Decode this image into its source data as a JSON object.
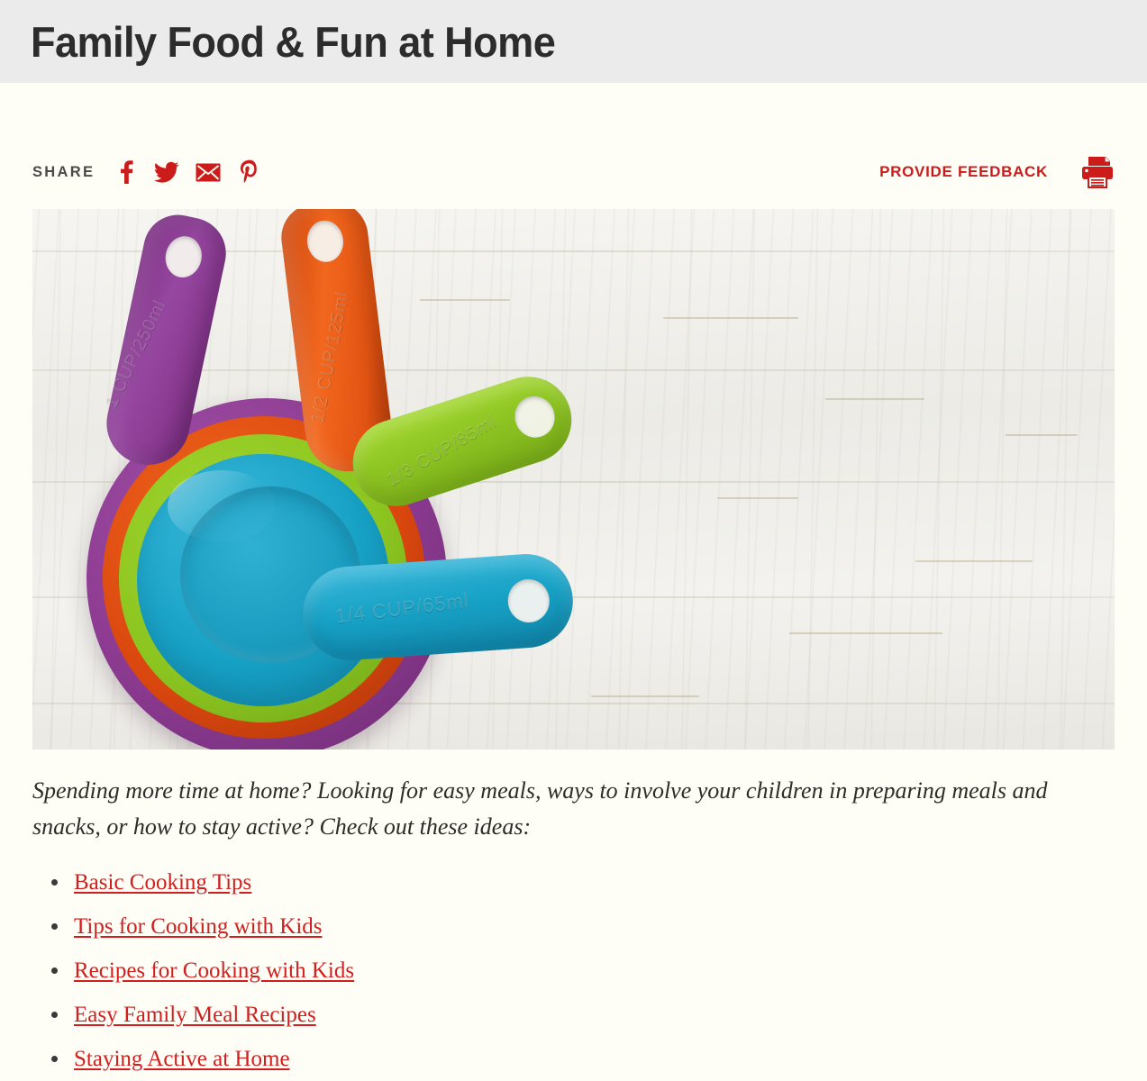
{
  "header": {
    "title": "Family Food & Fun at Home",
    "band_color": "#ebebeb",
    "title_color": "#2c2c2c"
  },
  "utility_bar": {
    "share_label": "SHARE",
    "social": [
      {
        "name": "facebook",
        "icon": "facebook-icon",
        "color": "#cc1b1b"
      },
      {
        "name": "twitter",
        "icon": "twitter-icon",
        "color": "#cc1b1b"
      },
      {
        "name": "email",
        "icon": "email-icon",
        "color": "#cc1b1b"
      },
      {
        "name": "pinterest",
        "icon": "pinterest-icon",
        "color": "#cc1b1b"
      }
    ],
    "feedback_label": "PROVIDE FEEDBACK",
    "feedback_color": "#cc1b1b",
    "print_icon": "printer-icon"
  },
  "hero_image": {
    "alt": "Stack of nested colorful plastic measuring cups on whitewashed wood",
    "cups": [
      {
        "color_name": "purple",
        "hex": "#8b3a90",
        "embossed_text": "1 CUP/250ml"
      },
      {
        "color_name": "orange",
        "hex": "#d9460e",
        "embossed_text": "1/2 CUP/125ml"
      },
      {
        "color_name": "green",
        "hex": "#8cc520",
        "embossed_text": "1/3 CUP/85ml"
      },
      {
        "color_name": "blue",
        "hex": "#17a2c6",
        "embossed_text": "1/4 CUP/65ml"
      }
    ],
    "background_color": "#f1f0ec"
  },
  "body": {
    "intro": "Spending more time at home? Looking for easy meals, ways to involve your children in preparing meals and snacks, or how to stay active? Check out these ideas:",
    "links": [
      "Basic Cooking Tips",
      "Tips for Cooking with Kids",
      "Recipes for Cooking with Kids",
      "Easy Family Meal Recipes",
      "Staying Active at Home"
    ],
    "link_color": "#d11f1f",
    "page_background": "#fefdf6"
  }
}
